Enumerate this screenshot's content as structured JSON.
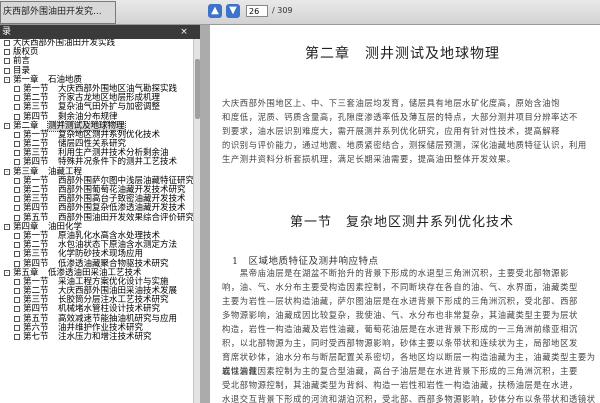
{
  "toolbar": {
    "doc_tab_label": "庆西部外围油田开发究...",
    "nav_up": "▲",
    "nav_down": "▼",
    "page_current": "26",
    "page_total": "/ 309"
  },
  "sidebar": {
    "header": "录",
    "close": "×",
    "items": [
      {
        "box": "",
        "prefix": "",
        "text": "大庆西部外围油田开发实践"
      },
      {
        "box": "",
        "prefix": "",
        "text": "版权页"
      },
      {
        "box": "",
        "prefix": "",
        "text": "前言"
      },
      {
        "box": "",
        "prefix": "",
        "text": "目录"
      },
      {
        "box": "-",
        "prefix": "第一章",
        "text": "石油地质"
      },
      {
        "box": "",
        "prefix": "第一节",
        "text": "大庆西部外围地区油气勘探实践"
      },
      {
        "box": "",
        "prefix": "第二节",
        "text": "齐家古龙地区地层形成机理"
      },
      {
        "box": "",
        "prefix": "第三节",
        "text": "复杂油气田外扩与加密调整"
      },
      {
        "box": "",
        "prefix": "第四节",
        "text": "剩余油分布规律"
      },
      {
        "box": "-",
        "prefix": "第二章",
        "text": "测井测试及地球物理",
        "selected": true
      },
      {
        "box": "",
        "prefix": "第一节",
        "text": "复杂地区测井系列优化技术"
      },
      {
        "box": "",
        "prefix": "第二节",
        "text": "储层四性关系研究"
      },
      {
        "box": "",
        "prefix": "第三节",
        "text": "利用生产测井技术分析剩余油"
      },
      {
        "box": "",
        "prefix": "第四节",
        "text": "特殊井况条件下的测井工艺技术"
      },
      {
        "box": "-",
        "prefix": "第三章",
        "text": "油藏工程"
      },
      {
        "box": "",
        "prefix": "第一节",
        "text": "西部外围萨尔图中浅层油藏特征研究"
      },
      {
        "box": "",
        "prefix": "第二节",
        "text": "西部外围葡萄花油藏开发技术研究"
      },
      {
        "box": "",
        "prefix": "第三节",
        "text": "西部外围高台子致密油藏开发技术"
      },
      {
        "box": "",
        "prefix": "第四节",
        "text": "西部外围复杂低渗透油藏开发技术"
      },
      {
        "box": "",
        "prefix": "第五节",
        "text": "西部外围油田开发效果综合评价研究"
      },
      {
        "box": "-",
        "prefix": "第四章",
        "text": "油田化学"
      },
      {
        "box": "",
        "prefix": "第一节",
        "text": "原油乳化水高含水处理技术"
      },
      {
        "box": "",
        "prefix": "第二节",
        "text": "水包油状态下原油含水测定方法"
      },
      {
        "box": "",
        "prefix": "第三节",
        "text": "化学防砂技术现场应用"
      },
      {
        "box": "",
        "prefix": "第四节",
        "text": "低渗透油藏聚合物驱技术研究"
      },
      {
        "box": "-",
        "prefix": "第五章",
        "text": "低渗透油田采油工艺技术"
      },
      {
        "box": "",
        "prefix": "第一节",
        "text": "采油工程方案优化设计与实施"
      },
      {
        "box": "",
        "prefix": "第二节",
        "text": "大庆西部外围油田采油技术发展"
      },
      {
        "box": "",
        "prefix": "第三节",
        "text": "长胶筒分层注水工艺技术研究"
      },
      {
        "box": "",
        "prefix": "第四节",
        "text": "机械堵水管柱设计技术研究"
      },
      {
        "box": "",
        "prefix": "第五节",
        "text": "高效减速节能抽油机研究与应用"
      },
      {
        "box": "",
        "prefix": "第六节",
        "text": "油井维护作业技术研究"
      },
      {
        "box": "",
        "prefix": "第七节",
        "text": "注水压力和增注技术研究"
      }
    ]
  },
  "page": {
    "chapter_title": "第二章　测井测试及地球物理",
    "intro_lines": [
      "大庆西部外围地区上、中、下三套油层均发育，储层具有地层水矿化度高，原始含油饱",
      "和度低，泥质、钙质含量高，孔隙度渗透率低及薄互层的特点，大部分测井项目分辨率达不",
      "到要求，油水层识别难度大，需开展测井系列优化研究，应用有针对性技术，提高解释",
      "的识别与评价能力，通过地震、地质紧密结合，测探储层预测，深化油藏地质特征认识，利用",
      "生产测井资料分析套损机理，满足长期采油需要，提高油田整体开发效果。"
    ],
    "section_title": "第一节　复杂地区测井系列优化技术",
    "subsection_title": "1　区域地质特征及测井响应特点",
    "body_lines": [
      "　　黑帝庙油层是在湖盆不断抬升的背景下形成的水退型三角洲沉积，主要受北部物源影",
      "响，油、气、水分布主要受构造因素控制，不同断块存在各自的油、气、水界面，油藏类型",
      "主要为岩性—层状构造油藏，萨尔图油层是在水进背景下形成的三角洲沉积，受北部、西部",
      "多物源影响，油藏成因比较复杂，我使油、气、水分布也非常复杂，其油藏类型主要为层状",
      "构造，岩性一构造油藏及岩性油藏，葡萄花油层是在水进背景下形成的一三角洲前缘亚相沉",
      "积，以北部物源为主，同时受西部物源影响，砂体主要以条带状和连续状为主，局部地区发",
      "育席状砂体，油水分布与断层配置关系密切，各地区均以断层一构造油藏为主，油藏类型主要为岩性油藏",
      "或以岩性因素控制为主的复合型油藏，高台子油层是在水进背景下形成的三角洲沉积，主要",
      "受北部物源控制，其油藏类型为背斜、构造一岩性和岩性一构造油藏，扶杨油层是在水进，",
      "水退交互背景下形成的河流和湖泊沉积，受北部、西部多物源影响，砂体分布以条带状和透镜状"
    ]
  }
}
